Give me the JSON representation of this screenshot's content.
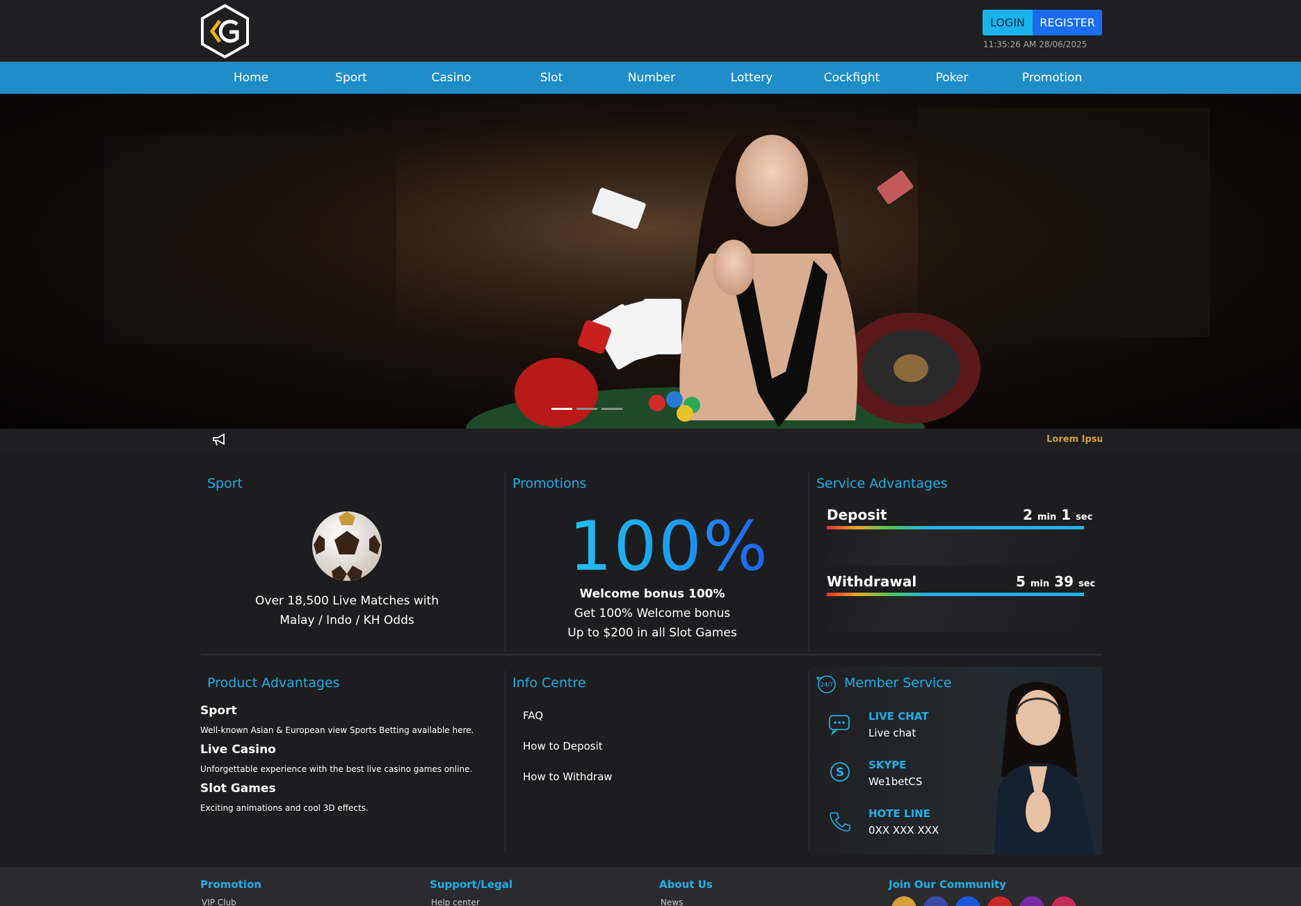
{
  "header": {
    "login_label": "LOGIN",
    "register_label": "REGISTER",
    "datetime": "11:35:26 AM 28/06/2025"
  },
  "nav": {
    "items": [
      "Home",
      "Sport",
      "Casino",
      "Slot",
      "Number",
      "Lottery",
      "Cockfight",
      "Poker",
      "Promotion"
    ]
  },
  "hero": {
    "slide_count": 3,
    "active_slide": 1
  },
  "announcement": {
    "text": "Lorem Ipsum"
  },
  "sport": {
    "title": "Sport",
    "line1": "Over 18,500 Live Matches with",
    "line2": "Malay / Indo / KH Odds"
  },
  "promotions": {
    "title": "Promotions",
    "big": "100%",
    "headline": "Welcome bonus 100%",
    "line1": "Get 100% Welcome bonus",
    "line2": "Up to $200 in all Slot Games"
  },
  "service": {
    "title": "Service Advantages",
    "deposit": {
      "label": "Deposit",
      "min": "2",
      "min_unit": "min",
      "sec": "1",
      "sec_unit": "sec"
    },
    "withdrawal": {
      "label": "Withdrawal",
      "min": "5",
      "min_unit": "min",
      "sec": "39",
      "sec_unit": "sec"
    }
  },
  "product": {
    "title": "Product Advantages",
    "items": [
      {
        "head": "Sport",
        "desc": "Well-known Asian & European view Sports Betting available here."
      },
      {
        "head": "Live Casino",
        "desc": "Unforgettable experience with the best live casino games online."
      },
      {
        "head": "Slot Games",
        "desc": "Exciting animations and cool 3D effects."
      }
    ]
  },
  "info": {
    "title": "Info Centre",
    "links": [
      "FAQ",
      "How to Deposit",
      "How to Withdraw"
    ]
  },
  "member": {
    "title": "Member Service",
    "badge": "24/7",
    "items": [
      {
        "label": "LIVE CHAT",
        "value": "Live chat"
      },
      {
        "label": "SKYPE",
        "value": "We1betCS"
      },
      {
        "label": "HOTE LINE",
        "value": "0XX XXX XXX"
      }
    ]
  },
  "footer": {
    "cols": [
      {
        "head": "Promotion",
        "sub": "VIP Club"
      },
      {
        "head": "Support/Legal",
        "sub": "Help center"
      },
      {
        "head": "About Us",
        "sub": "News"
      },
      {
        "head": "Join Our Community",
        "sub": ""
      }
    ],
    "social_colors": [
      "#d4a039",
      "#3a4aa8",
      "#1a5adf",
      "#c82a2a",
      "#7a2aa8",
      "#c82a5a"
    ]
  },
  "colors": {
    "accent": "#1fb0ea",
    "nav_bg": "#1f8ec8",
    "login_bg": "#1ab3ec",
    "register_bg": "#1a6cf0",
    "gold": "#d4a039"
  }
}
